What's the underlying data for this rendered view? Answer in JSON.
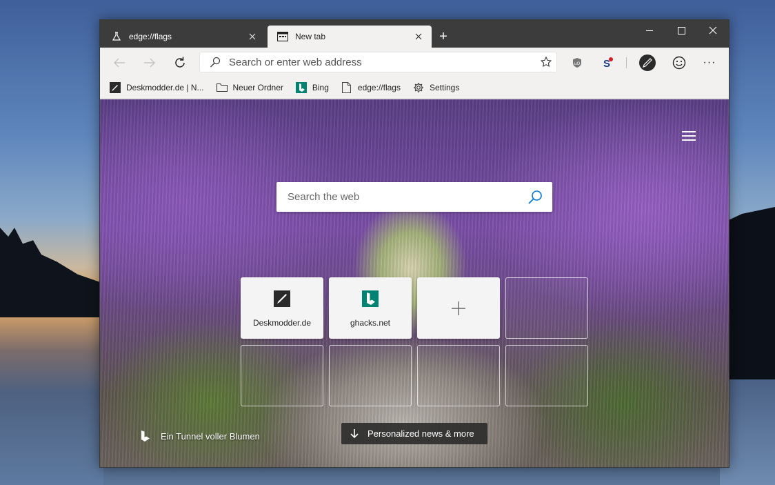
{
  "window": {
    "tabs": [
      {
        "title": "edge://flags",
        "icon": "flask-icon",
        "active": false
      },
      {
        "title": "New tab",
        "icon": "newtab-page-icon",
        "active": true
      }
    ],
    "new_tab_symbol": "+",
    "controls": {
      "minimize": "minimize-icon",
      "maximize": "maximize-icon",
      "close": "close-icon"
    }
  },
  "toolbar": {
    "address_placeholder": "Search or enter web address",
    "more_label": "···",
    "icons": [
      "back-arrow-icon",
      "forward-arrow-icon",
      "refresh-icon",
      "search-icon",
      "star-icon",
      "ublock-shield-icon",
      "extension-s-icon",
      "profile-pen-icon",
      "feedback-smiley-icon",
      "more-menu-icon"
    ]
  },
  "favorites": [
    {
      "label": "Deskmodder.de | N...",
      "icon": "deskmodder-icon"
    },
    {
      "label": "Neuer Ordner",
      "icon": "folder-icon"
    },
    {
      "label": "Bing",
      "icon": "bing-icon"
    },
    {
      "label": "edge://flags",
      "icon": "page-icon"
    },
    {
      "label": "Settings",
      "icon": "gear-icon"
    }
  ],
  "newtab": {
    "search_placeholder": "Search the web",
    "tiles": [
      {
        "label": "Deskmodder.de",
        "icon": "deskmodder-icon"
      },
      {
        "label": "ghacks.net",
        "icon": "bing-icon"
      },
      {
        "label": "",
        "icon": "plus-icon"
      }
    ],
    "image_credit": "Ein Tunnel voller Blumen",
    "news_button": "Personalized news & more"
  },
  "colors": {
    "bing_teal": "#008373",
    "titlebar": "#3c3c3c",
    "toolbar": "#f2f1f0",
    "search_icon_blue": "#0078d4"
  }
}
